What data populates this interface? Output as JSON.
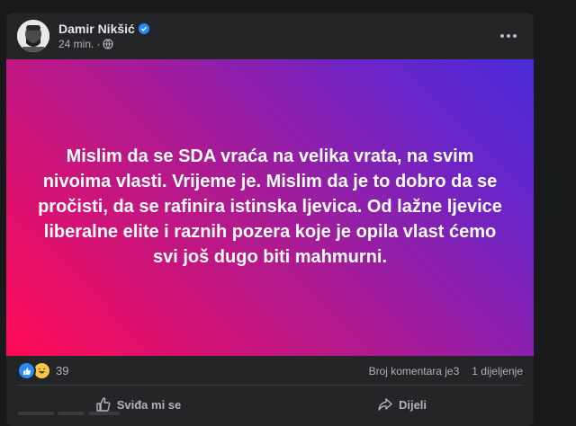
{
  "post": {
    "author": "Damir Nikšić",
    "time": "24 min.",
    "separator": "·",
    "text": "Mislim da se SDA vraća na velika vrata, na svim nivoima vlasti. Vrijeme je. Mislim da je to dobro da se pročisti, da se rafinira istinska ljevica. Od lažne ljevice liberalne elite i raznih pozera koje je opila vlast ćemo svi još dugo biti mahmurni.",
    "background_colors": [
      "#ff0a54",
      "#b01a8f",
      "#6a25c9",
      "#4a2ad8"
    ]
  },
  "stats": {
    "reaction_count": "39",
    "comments": "Broj komentara je3",
    "shares": "1 dijeljenje"
  },
  "actions": {
    "like": "Sviđa mi se",
    "share": "Dijeli"
  },
  "icons": {
    "verified": "verified-badge-icon",
    "privacy": "globe-icon",
    "more": "more-options-icon",
    "like": "thumbs-up-icon",
    "haha": "laughing-face-icon",
    "share": "share-arrow-icon"
  }
}
